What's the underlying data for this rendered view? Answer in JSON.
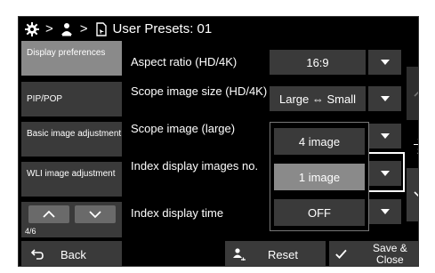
{
  "header": {
    "separator": ">",
    "title": "User Presets: 01",
    "icons": [
      "gear-icon",
      "user-icon",
      "document-arrow-icon"
    ]
  },
  "nav": {
    "items": [
      {
        "label": "Display preferences",
        "active": true
      },
      {
        "label": "PIP/POP",
        "active": false
      },
      {
        "label": "Basic image adjustment",
        "active": false
      },
      {
        "label": "WLI image adjustment",
        "active": false
      }
    ],
    "page": "4/6"
  },
  "rows": [
    {
      "label": "Aspect ratio (HD/4K)",
      "value": "16:9"
    },
    {
      "label": "Scope image size (HD/4K)",
      "value": "Large ⇔ Small"
    },
    {
      "label": "Scope image (large)",
      "value": ""
    },
    {
      "label": "Index display images no.",
      "value": ""
    },
    {
      "label": "Index display time",
      "value": ""
    }
  ],
  "dropdown": {
    "options": [
      "4 image",
      "1 image",
      "OFF"
    ],
    "selected": "1 image"
  },
  "scroll": {
    "current": "1",
    "total": "3"
  },
  "footer": {
    "back_label": "Back",
    "reset_label": "Reset",
    "save_label": "Save & Close"
  },
  "colors": {
    "background": "#000000",
    "button": "#3a3a3a",
    "active": "#8a8a8a",
    "text": "#ffffff"
  }
}
